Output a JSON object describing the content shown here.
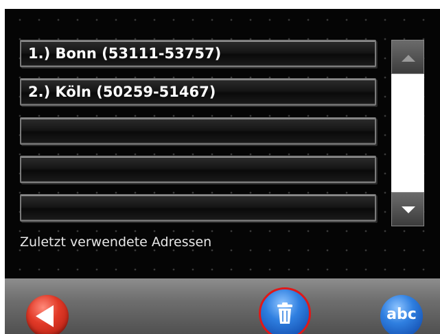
{
  "address_list": {
    "items": [
      {
        "label": "1.) Bonn (53111-53757)"
      },
      {
        "label": "2.) Köln (50259-51467)"
      },
      {
        "label": ""
      },
      {
        "label": ""
      },
      {
        "label": ""
      }
    ]
  },
  "caption": "Zuletzt verwendete Adressen",
  "bottom_bar": {
    "back_icon": "back-arrow-icon",
    "trash_icon": "trash-icon",
    "keyboard_label": "abc"
  },
  "colors": {
    "background": "#050505",
    "back_button": "#e23a28",
    "trash_button": "#2f7fe0",
    "trash_highlight_ring": "#e01818",
    "keyboard_button": "#2f7fe0"
  }
}
